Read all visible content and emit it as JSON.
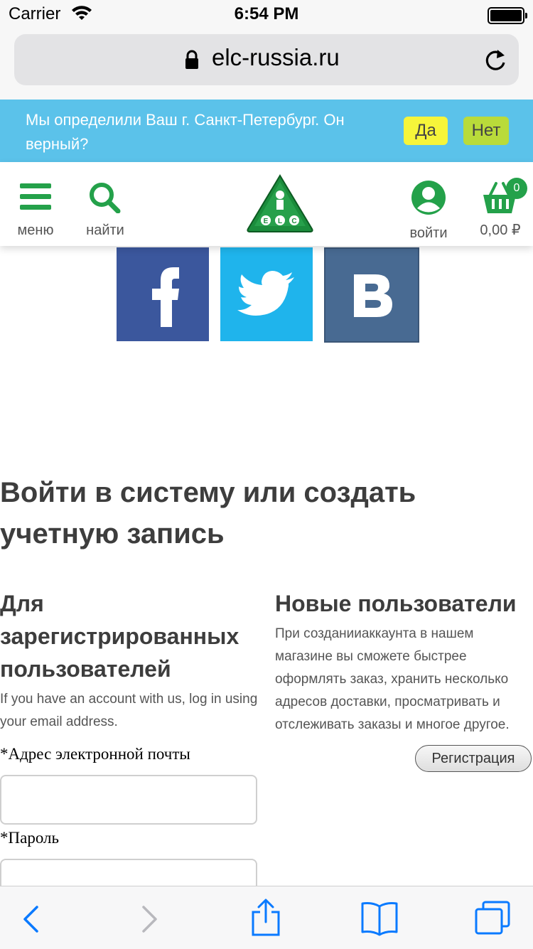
{
  "status_bar": {
    "carrier": "Carrier",
    "time": "6:54 PM"
  },
  "browser": {
    "url": "elc-russia.ru"
  },
  "region_banner": {
    "message": "Мы определили Ваш г. Санкт-Петербург. Он верный?",
    "yes_label": "Да",
    "no_label": "Нет"
  },
  "header": {
    "menu_label": "меню",
    "search_label": "найти",
    "login_label": "войти",
    "cart_count": "0",
    "cart_total": "0,00 ₽",
    "logo_text": "ELC"
  },
  "social": [
    {
      "name": "facebook",
      "glyph": "f"
    },
    {
      "name": "twitter",
      "glyph": ""
    },
    {
      "name": "vkontakte",
      "glyph": "B"
    }
  ],
  "page": {
    "title": "Войти в систему или создать учетную запись",
    "registered": {
      "heading": "Для зарегистрированных пользователей",
      "description": "If you have an account with us, log in using your email address.",
      "email_label": "*Адрес электронной почты",
      "password_label": "*Пароль",
      "email_value": "",
      "password_value": ""
    },
    "new_users": {
      "heading": "Новые пользователи",
      "description": "При созданииаккаунта в нашем магазине вы сможете быстрее оформлять заказ, хранить несколько адресов доставки, просматривать и отслеживать заказы и многое другое.",
      "register_label": "Регистрация"
    }
  },
  "colors": {
    "banner_bg": "#5bc2ea",
    "yes_bg": "#f6f53a",
    "no_bg": "#b9db3a",
    "brand_green": "#24a14a",
    "facebook": "#3b579d",
    "twitter": "#1fb4ec",
    "vk": "#486a92",
    "ios_blue": "#0a7aff"
  },
  "toolbar_icons": [
    "back-icon",
    "forward-icon",
    "share-icon",
    "bookmarks-icon",
    "tabs-icon"
  ]
}
